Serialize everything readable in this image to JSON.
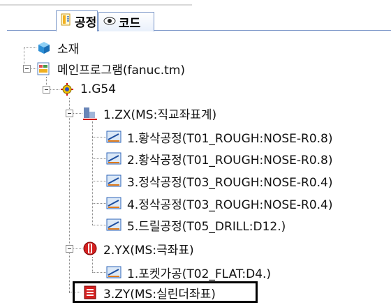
{
  "tabs": [
    {
      "label": "공정",
      "icon": "process-icon",
      "active": true
    },
    {
      "label": "코드",
      "icon": "eye-icon",
      "active": false
    }
  ],
  "tree": {
    "material": "소재",
    "main_program": "메인프로그램(fanuc.tm)",
    "g54": "1.G54",
    "zx": "1.ZX(MS:직교좌표계)",
    "zx_items": [
      "1.황삭공정(T01_ROUGH:NOSE-R0.8)",
      "2.황삭공정(T01_ROUGH:NOSE-R0.8)",
      "3.정삭공정(T03_ROUGH:NOSE-R0.4)",
      "4.정삭공정(T03_ROUGH:NOSE-R0.4)",
      "5.드릴공정(T05_DRILL:D12.)"
    ],
    "yx": "2.YX(MS:극좌표)",
    "yx_items": [
      "1.포켓가공(T02_FLAT:D4.)"
    ],
    "zy": "3.ZY(MS:실린더좌표)"
  },
  "colors": {
    "accent": "#7a96c8",
    "selection_border": "#000000"
  }
}
